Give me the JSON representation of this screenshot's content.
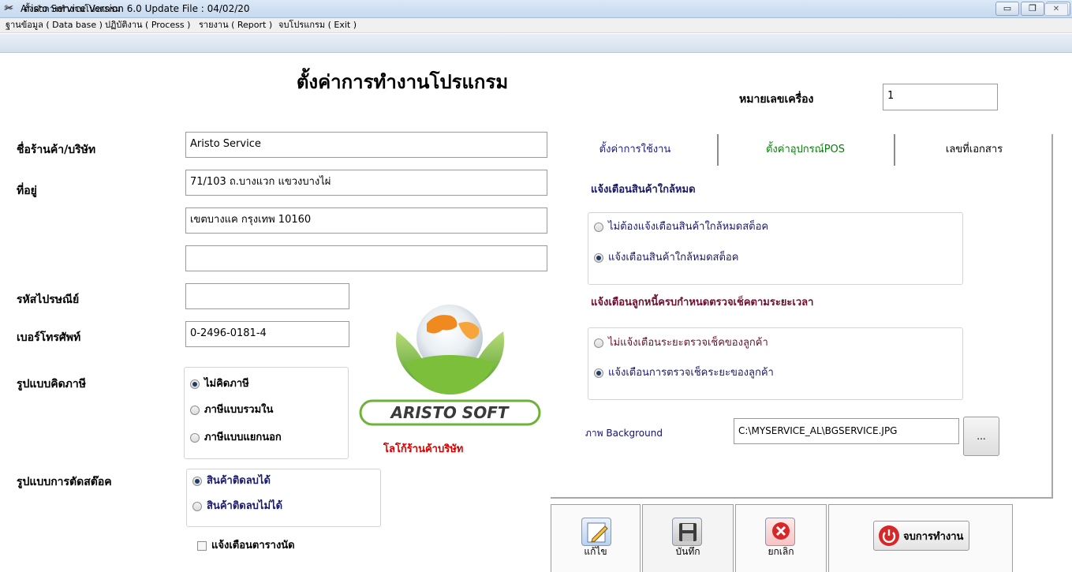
{
  "window": {
    "title": "Aristo Service Version 6.0 Update File : 04/02/20",
    "minimize_glyph": "▭",
    "restore_glyph": "❐",
    "close_glyph": "✕"
  },
  "menu": {
    "items": [
      {
        "label": "ฐานข้อมูล ( Data base )"
      },
      {
        "label": "ปฏิบัติงาน ( Process )"
      },
      {
        "label": "รายงาน ( Report )"
      },
      {
        "label": "จบโปรแกรม ( Exit )"
      }
    ]
  },
  "form": {
    "title": "ตั้งค่าการทำงานโปรแกรม",
    "close_glyph": "✕",
    "heading": "ตั้งค่าการทำงานโปรแกรม",
    "machine_label": "หมายเลขเครื่อง",
    "machine_value": "1",
    "company_label": "ชื่อร้านค้า/บริษัท",
    "company_value": "Aristo Service",
    "address_label": "ที่อยู่",
    "address_line1": "71/103 ถ.บางแวก แขวงบางไผ่",
    "address_line2": "เขตบางแค กรุงเทพ 10160",
    "address_line3": "",
    "postal_label": "รหัสไปรษณีย์",
    "postal_value": "",
    "phone_label": "เบอร์โทรศัพท์",
    "phone_value": "0-2496-0181-4",
    "tax_label": "รูปแบบคิดภาษี",
    "tax_options": [
      {
        "label": "ไม่คิดภาษี",
        "selected": true
      },
      {
        "label": "ภาษีแบบรวมใน",
        "selected": false
      },
      {
        "label": "ภาษีแบบแยกนอก",
        "selected": false
      }
    ],
    "stock_label": "รูปแบบการตัดสต๊อค",
    "stock_options": [
      {
        "label": "สินค้าติดลบได้",
        "selected": true
      },
      {
        "label": "สินค้าติดลบไม่ได้",
        "selected": false
      }
    ],
    "appointment_check": {
      "label": "แจ้งเตือนตารางนัด",
      "checked": false
    },
    "logo_text": "ARISTO SOFT",
    "logo_caption": "โลโก้ร้านค้าบริษัท"
  },
  "tabs": [
    {
      "label": "ตั้งค่าการใช้งาน",
      "active": true
    },
    {
      "label": "ตั้งค่าอุปกรณ์POS",
      "active": false
    },
    {
      "label": "เลขที่เอกสาร",
      "active": false
    }
  ],
  "usage_tab": {
    "stock_alert_title": "แจ้งเตือนสินค้าใกล้หมด",
    "stock_alert_options": [
      {
        "label": "ไม่ต้องแจ้งเตือนสินค้าใกล้หมดสต็อค",
        "selected": false
      },
      {
        "label": "แจ้งเตือนสินค้าใกล้หมดสต็อค",
        "selected": true
      }
    ],
    "debtor_alert_title": "แจ้งเตือนลูกหนี้ครบกำหนดตรวจเช็คตามระยะเวลา",
    "debtor_alert_options": [
      {
        "label": "ไม่แจ้งเตือนระยะตรวจเช็คของลูกค้า",
        "selected": false
      },
      {
        "label": "แจ้งเตือนการตรวจเช็คระยะของลูกค้า",
        "selected": true
      }
    ],
    "background_label": "ภาพ Background",
    "background_value": "C:\\MYSERVICE_AL\\BGSERVICE.JPG",
    "browse_label": "..."
  },
  "toolbar": {
    "edit_label": "แก้ไข",
    "save_label": "บันทึก",
    "cancel_label": "ยกเลิก",
    "exit_label": "จบการทำงาน"
  },
  "colors": {
    "tab_active_text": "#1a1a8a",
    "tab_pos_text": "#0a7a0a",
    "stock_alert_text": "#1a1a6a",
    "debtor_alert_text": "#6a1030",
    "logo_caption": "#d40000"
  }
}
